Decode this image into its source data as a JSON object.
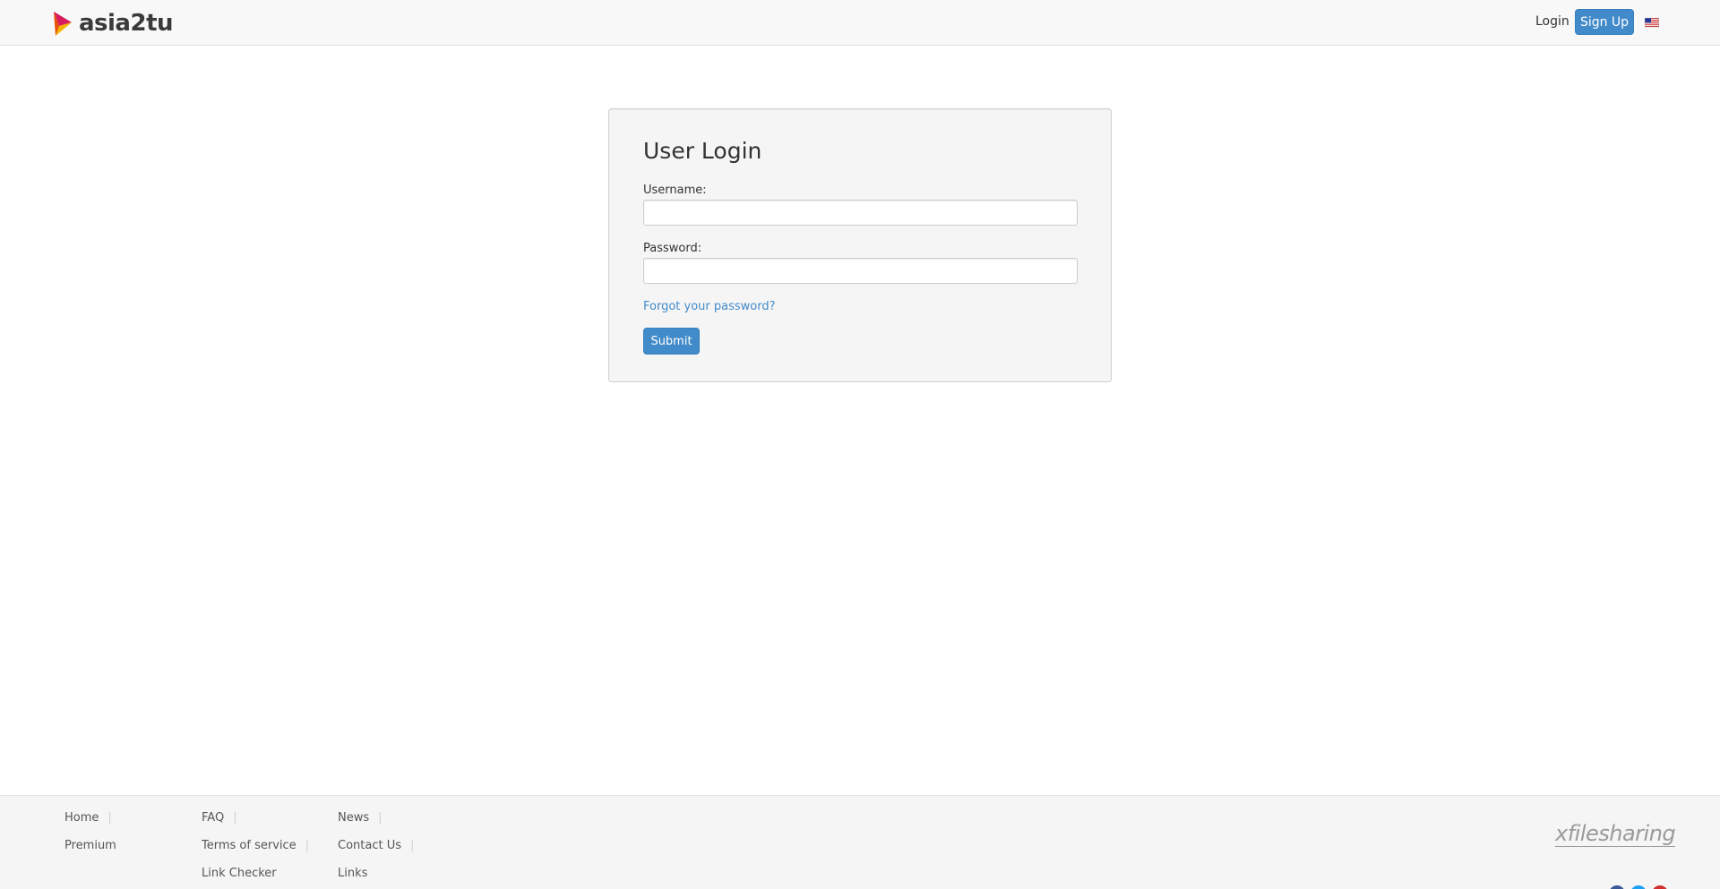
{
  "header": {
    "brand": "asia2tu",
    "login_label": "Login",
    "signup_label": "Sign Up",
    "language": "en-US flag"
  },
  "login_form": {
    "title": "User Login",
    "username_label": "Username:",
    "username_value": "",
    "password_label": "Password:",
    "password_value": "",
    "forgot_label": "Forgot your password?",
    "submit_label": "Submit"
  },
  "footer": {
    "columns": [
      [
        {
          "label": "Home"
        },
        {
          "label": "Premium"
        }
      ],
      [
        {
          "label": "FAQ"
        },
        {
          "label": "Terms of service"
        },
        {
          "label": "Link Checker"
        }
      ],
      [
        {
          "label": "News"
        },
        {
          "label": "Contact Us"
        },
        {
          "label": "Links"
        }
      ]
    ],
    "powered_by": "xfilesharing"
  },
  "colors": {
    "primary": "#428bca",
    "header_bg": "#f8f8f8",
    "panel_bg": "#f5f5f5",
    "footer_bg": "#f5f5f5"
  }
}
